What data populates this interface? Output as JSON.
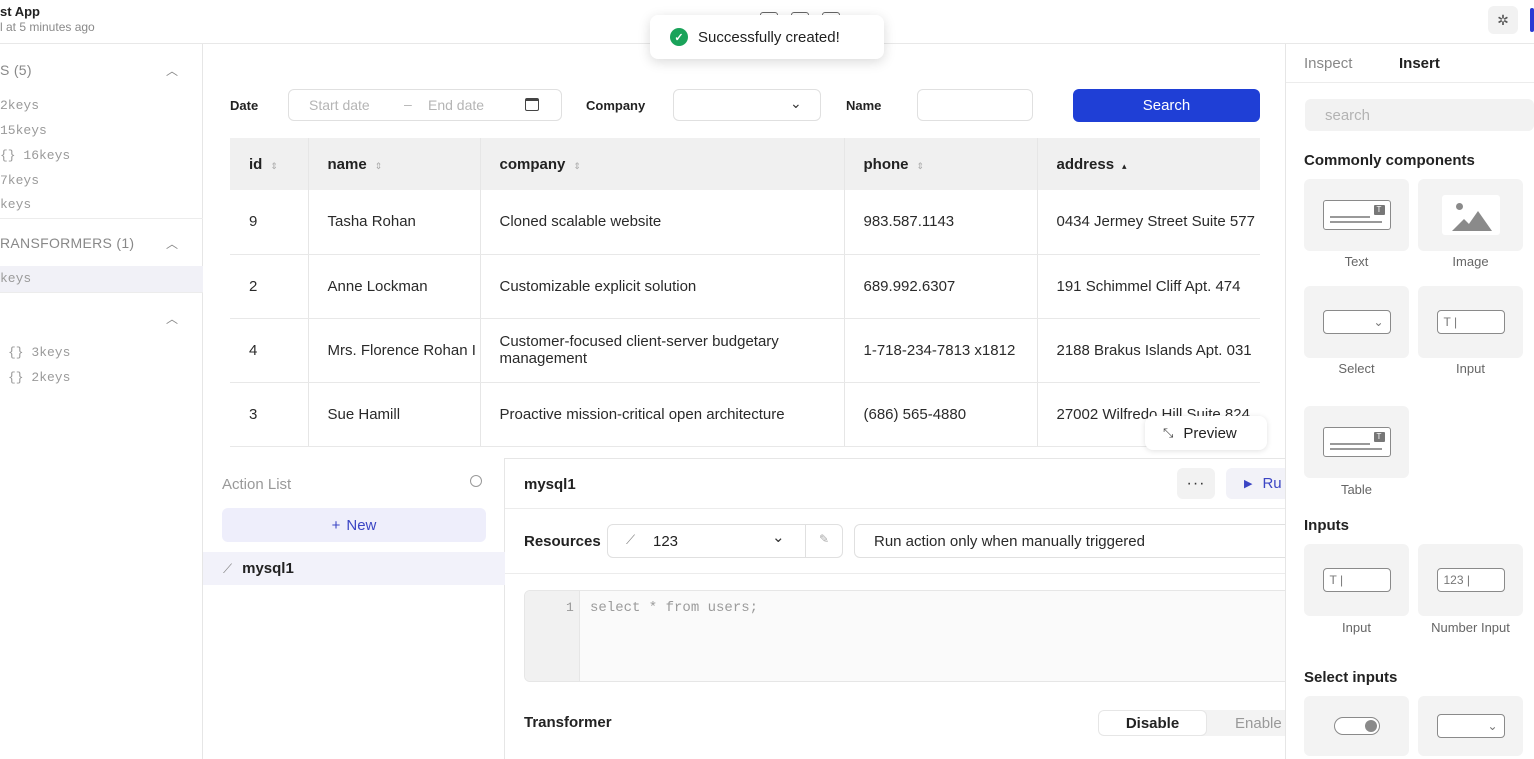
{
  "header": {
    "app_title": "st App",
    "app_subtitle": "l at 5 minutes ago"
  },
  "toast": {
    "message": "Successfully created!"
  },
  "left_panel": {
    "section1_title": "S (5)",
    "section1_items": [
      "2keys",
      "15keys",
      "{} 16keys",
      "7keys",
      "keys"
    ],
    "section2_title": "RANSFORMERS (1)",
    "section2_items": [
      "keys"
    ],
    "section3_items": [
      "{} 3keys",
      "{} 2keys"
    ]
  },
  "filters": {
    "date_label": "Date",
    "start_placeholder": "Start date",
    "range_separator": "–",
    "end_placeholder": "End date",
    "company_label": "Company",
    "name_label": "Name",
    "search_label": "Search"
  },
  "table": {
    "columns": [
      "id",
      "name",
      "company",
      "phone",
      "address"
    ],
    "rows": [
      {
        "id": "9",
        "name": "Tasha Rohan",
        "company": "Cloned scalable website",
        "phone": "983.587.1143",
        "address": "0434 Jermey Street Suite 577"
      },
      {
        "id": "2",
        "name": "Anne Lockman",
        "company": "Customizable explicit solution",
        "phone": "689.992.6307",
        "address": "191 Schimmel Cliff Apt. 474"
      },
      {
        "id": "4",
        "name": "Mrs. Florence Rohan I",
        "company": "Customer-focused client-server budgetary management",
        "phone": "1-718-234-7813 x1812",
        "address": "2188 Brakus Islands Apt. 031"
      },
      {
        "id": "3",
        "name": "Sue Hamill",
        "company": "Proactive mission-critical open architecture",
        "phone": "(686) 565-4880",
        "address": "27002 Wilfredo Hill Suite 824"
      }
    ],
    "preview_label": "Preview"
  },
  "action_list": {
    "title": "Action List",
    "new_label": "New",
    "items": [
      "mysql1"
    ]
  },
  "action_editor": {
    "title": "mysql1",
    "more_label": "···",
    "run_label": "Ru",
    "resources_label": "Resources",
    "resource_value": "123",
    "trigger_value": "Run action only when manually triggered",
    "line_number": "1",
    "code": "select * from users;",
    "transformer_label": "Transformer",
    "disable_label": "Disable",
    "enable_label": "Enable"
  },
  "right_panel": {
    "tabs": [
      "Inspect",
      "Insert"
    ],
    "active_tab": "Insert",
    "search_placeholder": "search",
    "common_heading": "Commonly components",
    "common_components": [
      "Text",
      "Image",
      "Select",
      "Input",
      "Table"
    ],
    "inputs_heading": "Inputs",
    "inputs_components": [
      "Input",
      "Number Input"
    ],
    "select_inputs_heading": "Select inputs",
    "number_input_preview": "123"
  },
  "colors": {
    "primary": "#1f3fd6",
    "success": "#1aa35a",
    "accent_soft": "#eeeefb"
  }
}
